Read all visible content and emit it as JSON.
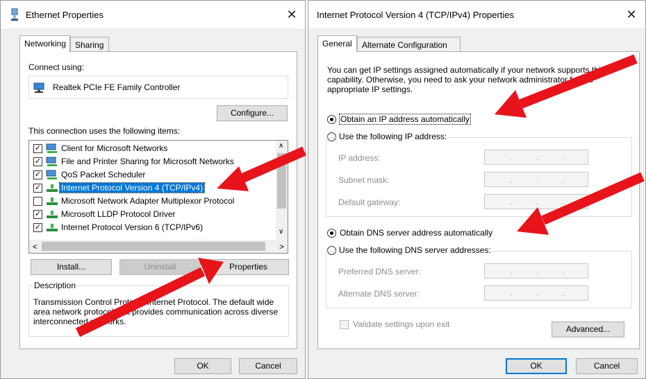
{
  "left": {
    "title": "Ethernet Properties",
    "close": "✕",
    "tabs": [
      "Networking",
      "Sharing"
    ],
    "connect_using_label": "Connect using:",
    "adapter_name": "Realtek PCIe FE Family Controller",
    "configure_label": "Configure...",
    "items_label": "This connection uses the following items:",
    "items": [
      {
        "label": "Client for Microsoft Networks",
        "checked": true
      },
      {
        "label": "File and Printer Sharing for Microsoft Networks",
        "checked": true
      },
      {
        "label": "QoS Packet Scheduler",
        "checked": true
      },
      {
        "label": "Internet Protocol Version 4 (TCP/IPv4)",
        "checked": true,
        "selected": true
      },
      {
        "label": "Microsoft Network Adapter Multiplexor Protocol",
        "checked": false
      },
      {
        "label": "Microsoft LLDP Protocol Driver",
        "checked": true
      },
      {
        "label": "Internet Protocol Version 6 (TCP/IPv6)",
        "checked": true
      }
    ],
    "check_mark": "✓",
    "scroll_up": "∧",
    "scroll_down": "∨",
    "scroll_left": "<",
    "scroll_right": ">",
    "install_label": "Install...",
    "uninstall_label": "Uninstall",
    "properties_label": "Properties",
    "description_legend": "Description",
    "description_text": "Transmission Control Protocol/Internet Protocol. The default wide area network protocol that provides communication across diverse interconnected networks.",
    "ok_label": "OK",
    "cancel_label": "Cancel"
  },
  "right": {
    "title": "Internet Protocol Version 4 (TCP/IPv4) Properties",
    "close": "✕",
    "tabs": [
      "General",
      "Alternate Configuration"
    ],
    "intro": "You can get IP settings assigned automatically if your network supports this capability. Otherwise, you need to ask your network administrator for the appropriate IP settings.",
    "auto_ip_label": "Obtain an IP address automatically",
    "manual_ip_label": "Use the following IP address:",
    "ip_address_label": "IP address:",
    "subnet_mask_label": "Subnet mask:",
    "default_gateway_label": "Default gateway:",
    "auto_dns_label": "Obtain DNS server address automatically",
    "manual_dns_label": "Use the following DNS server addresses:",
    "preferred_dns_label": "Preferred DNS server:",
    "alternate_dns_label": "Alternate DNS server:",
    "ip_dot": ".",
    "validate_label": "Validate settings upon exit",
    "advanced_label": "Advanced...",
    "ok_label": "OK",
    "cancel_label": "Cancel"
  },
  "colors": {
    "annotation_arrow": "#e8141b",
    "selection": "#0078d7",
    "dialog_bg": "#f0f0f0"
  }
}
